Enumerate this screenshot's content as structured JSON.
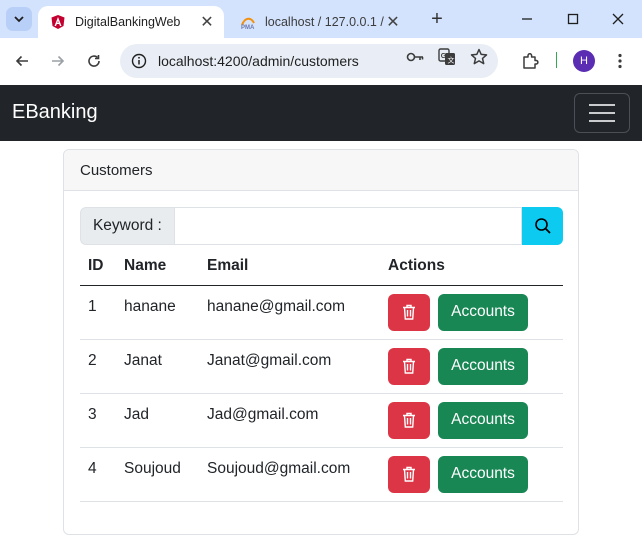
{
  "browser": {
    "tabs": [
      {
        "title": "DigitalBankingWeb",
        "active": true
      },
      {
        "title": "localhost / 127.0.0.1 / d",
        "active": false
      }
    ],
    "url": "localhost:4200/admin/customers",
    "profile_initial": "H",
    "theme_color": "#d3e3fd"
  },
  "navbar": {
    "brand": "EBanking",
    "background": "#212529"
  },
  "card": {
    "header": "Customers",
    "search": {
      "label": "Keyword :",
      "value": "",
      "button_icon": "search-icon",
      "button_color": "#0dcaf0"
    },
    "table": {
      "headers": [
        "ID",
        "Name",
        "Email",
        "Actions"
      ],
      "rows": [
        {
          "id": "1",
          "name": "hanane",
          "email": "hanane@gmail.com"
        },
        {
          "id": "2",
          "name": "Janat",
          "email": "Janat@gmail.com"
        },
        {
          "id": "3",
          "name": "Jad",
          "email": "Jad@gmail.com"
        },
        {
          "id": "4",
          "name": "Soujoud",
          "email": "Soujoud@gmail.com"
        }
      ],
      "delete_icon": "trash-icon",
      "delete_color": "#dc3545",
      "accounts_label": "Accounts",
      "accounts_color": "#198754"
    }
  }
}
